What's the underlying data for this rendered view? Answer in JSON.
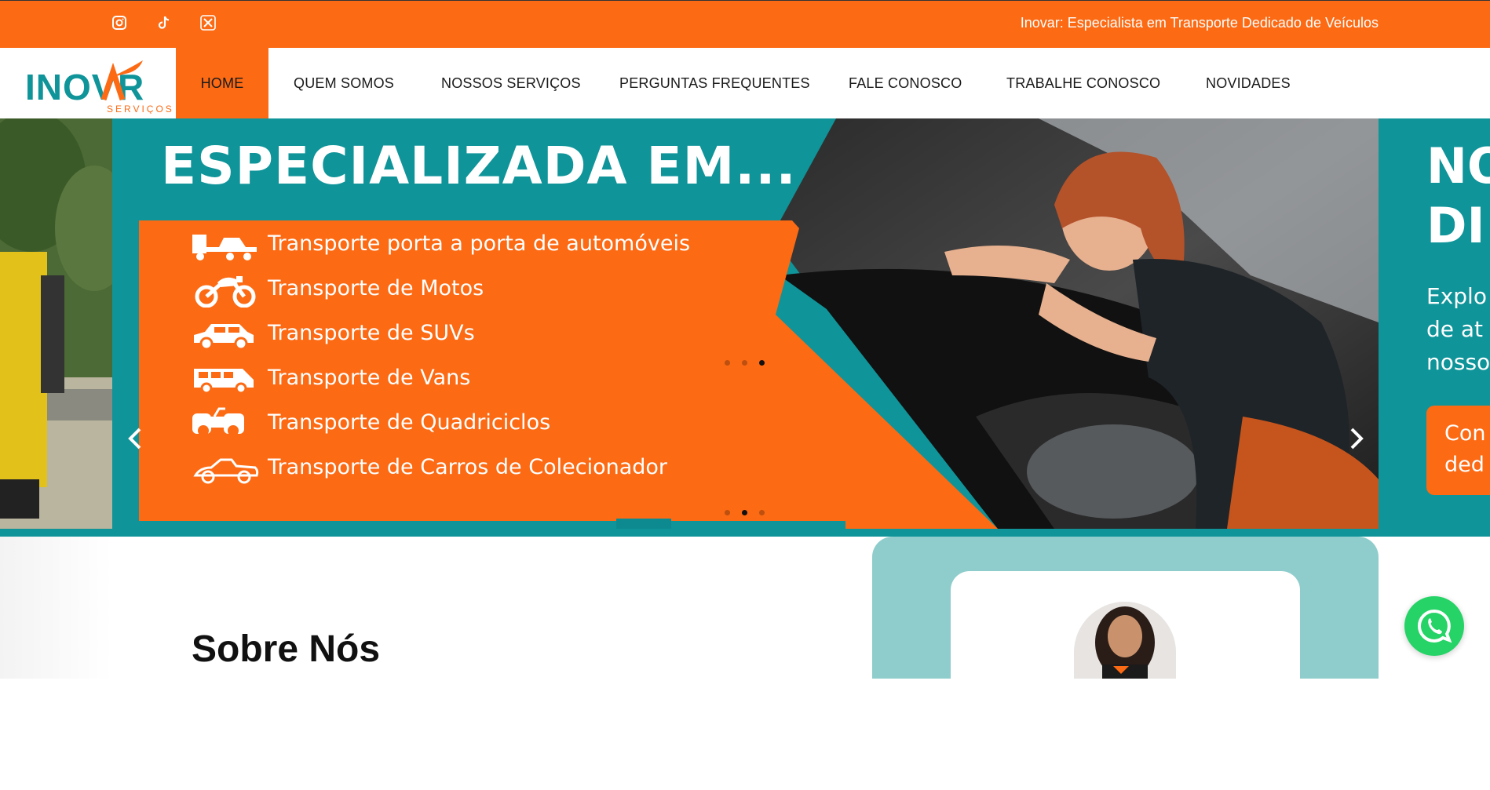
{
  "topbar": {
    "tagline": "Inovar: Especialista em Transporte Dedicado de Veículos",
    "social_icons": [
      "instagram-icon",
      "tiktok-icon",
      "x-icon"
    ]
  },
  "logo": {
    "main": "INOVAR",
    "sub": "SERVIÇOS"
  },
  "nav": {
    "items": [
      {
        "label": "HOME",
        "active": true
      },
      {
        "label": "QUEM SOMOS"
      },
      {
        "label": "NOSSOS SERVIÇOS"
      },
      {
        "label": "PERGUNTAS FREQUENTES"
      },
      {
        "label": "FALE CONOSCO"
      },
      {
        "label": "TRABALHE CONOSCO"
      },
      {
        "label": "NOVIDADES"
      }
    ]
  },
  "hero": {
    "heading": "ESPECIALIZADA EM...",
    "services": [
      {
        "label": "Transporte porta a porta de automóveis",
        "icon": "tow-truck-icon"
      },
      {
        "label": "Transporte de Motos",
        "icon": "motorcycle-icon"
      },
      {
        "label": "Transporte de SUVs",
        "icon": "suv-icon"
      },
      {
        "label": "Transporte de Vans",
        "icon": "van-icon"
      },
      {
        "label": "Transporte de Quadriciclos",
        "icon": "quad-icon"
      },
      {
        "label": "Transporte de Carros de Colecionador",
        "icon": "classic-car-icon"
      }
    ],
    "next_slide": {
      "heading_lines": [
        "NO",
        "DI"
      ],
      "text_lines": [
        "Explo",
        "de at",
        "nosso"
      ],
      "button_lines": [
        "Con",
        "ded"
      ]
    },
    "colors": {
      "orange": "#fc6a14",
      "teal": "#0f9499"
    }
  },
  "about": {
    "title": "Sobre Nós"
  },
  "whatsapp": {
    "icon": "whatsapp-icon"
  }
}
